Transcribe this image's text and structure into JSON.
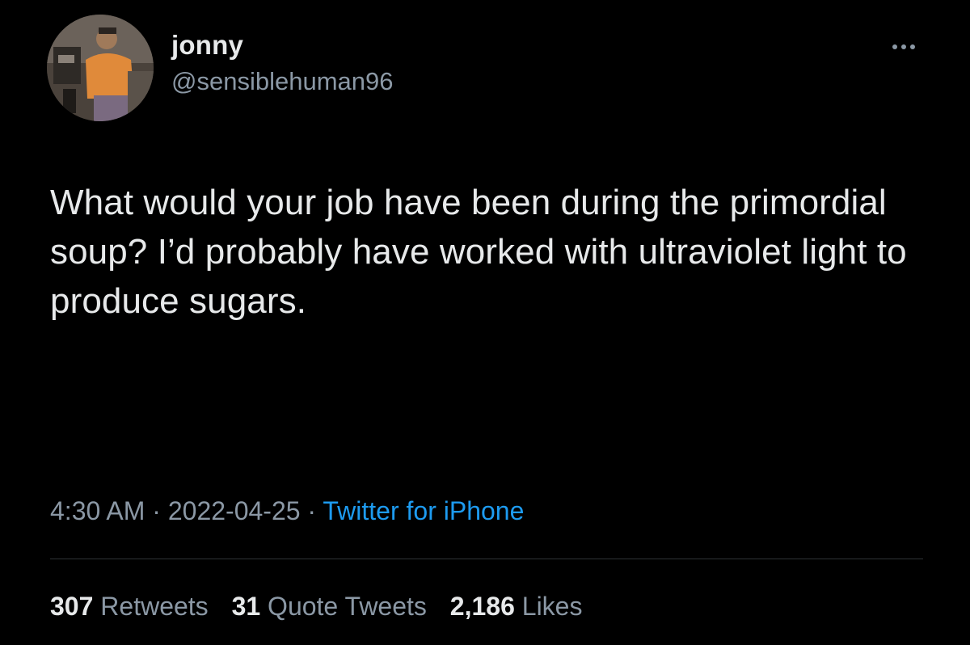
{
  "author": {
    "display_name": "jonny",
    "handle": "@sensiblehuman96"
  },
  "menu": {
    "icon": "more-horizontal-icon"
  },
  "tweet": {
    "text": "What would your job have been during the primordial soup? I’d probably have worked with ultraviolet light to produce sugars."
  },
  "meta": {
    "time": "4:30 AM",
    "separator": " · ",
    "date": "2022-04-25",
    "source": "Twitter for iPhone"
  },
  "stats": {
    "retweets": {
      "count": "307",
      "label": "Retweets"
    },
    "quotes": {
      "count": "31",
      "label": "Quote Tweets"
    },
    "likes": {
      "count": "2,186",
      "label": "Likes"
    }
  },
  "colors": {
    "background": "#000000",
    "primary_text": "#e7e9ea",
    "secondary_text": "#8b98a5",
    "link": "#1d9bf0",
    "divider": "#2f3336"
  }
}
